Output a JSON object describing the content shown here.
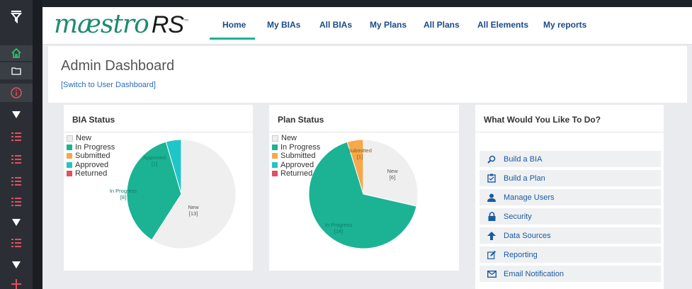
{
  "app": {
    "logo_text": "mæstro",
    "logo_suffix": "RS",
    "logo_tm": "TM"
  },
  "nav": {
    "items": [
      "Home",
      "My BIAs",
      "All BIAs",
      "My Plans",
      "All Plans",
      "All Elements",
      "My reports"
    ],
    "active": "Home"
  },
  "page": {
    "title": "Admin Dashboard",
    "switch_link": "[Switch to User Dashboard]"
  },
  "bia_status": {
    "title": "BIA Status",
    "legend": [
      {
        "label": "New",
        "color": "#efefef"
      },
      {
        "label": "In Progress",
        "color": "#1bb394"
      },
      {
        "label": "Submitted",
        "color": "#f6a84b"
      },
      {
        "label": "Approved",
        "color": "#20c5c9"
      },
      {
        "label": "Returned",
        "color": "#e34f5f"
      }
    ],
    "slice_labels": {
      "new": "New",
      "new_count": "[13]",
      "in_progress": "In Progress",
      "in_progress_count": "[8]",
      "approved": "Approved",
      "approved_count": "[1]"
    }
  },
  "plan_status": {
    "title": "Plan Status",
    "legend": [
      {
        "label": "New",
        "color": "#efefef"
      },
      {
        "label": "In Progress",
        "color": "#1bb394"
      },
      {
        "label": "Submitted",
        "color": "#f6a84b"
      },
      {
        "label": "Approved",
        "color": "#20c5c9"
      },
      {
        "label": "Returned",
        "color": "#e34f5f"
      }
    ],
    "slice_labels": {
      "new": "New",
      "new_count": "[6]",
      "in_progress": "In Progress",
      "in_progress_count": "[14]",
      "submitted": "Submitted",
      "submitted_count": "[1]"
    }
  },
  "chart_data": [
    {
      "type": "pie",
      "title": "BIA Status",
      "categories": [
        "New",
        "In Progress",
        "Submitted",
        "Approved",
        "Returned"
      ],
      "values": [
        13,
        8,
        0,
        1,
        0
      ],
      "colors": [
        "#efefef",
        "#1bb394",
        "#f6a84b",
        "#20c5c9",
        "#e34f5f"
      ],
      "legend": "top-left"
    },
    {
      "type": "pie",
      "title": "Plan Status",
      "categories": [
        "New",
        "In Progress",
        "Submitted",
        "Approved",
        "Returned"
      ],
      "values": [
        6,
        14,
        1,
        0,
        0
      ],
      "colors": [
        "#efefef",
        "#1bb394",
        "#f6a84b",
        "#20c5c9",
        "#e34f5f"
      ],
      "legend": "top-left"
    }
  ],
  "actions_panel": {
    "title": "What Would You Like To Do?",
    "items": [
      {
        "label": "Build a BIA",
        "icon": "search-icon"
      },
      {
        "label": "Build a Plan",
        "icon": "clipboard-icon"
      },
      {
        "label": "Manage Users",
        "icon": "user-icon"
      },
      {
        "label": "Security",
        "icon": "lock-icon"
      },
      {
        "label": "Data Sources",
        "icon": "arrow-up-icon"
      },
      {
        "label": "Reporting",
        "icon": "edit-icon"
      },
      {
        "label": "Email Notification",
        "icon": "envelope-icon"
      }
    ]
  },
  "sidebar": {
    "icons": [
      "funnel-icon",
      "home-icon",
      "folder-icon",
      "info-icon",
      "triangle-down-icon",
      "list-icon",
      "list-icon",
      "list-icon",
      "list-icon",
      "triangle-down-icon",
      "list-icon",
      "triangle-down-icon",
      "plus-icon"
    ]
  }
}
